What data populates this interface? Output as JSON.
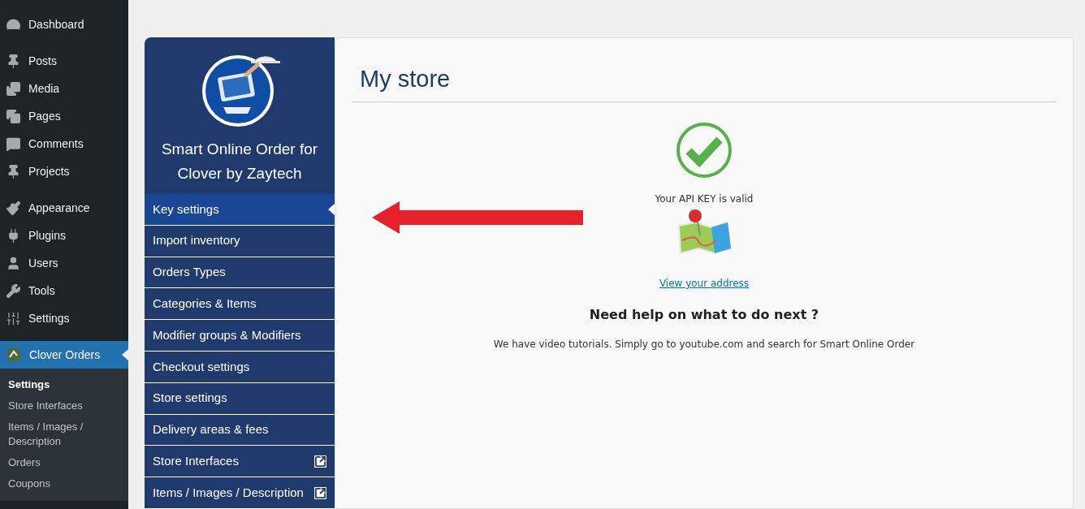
{
  "admin_menu": {
    "groups": [
      [
        {
          "label": "Dashboard",
          "kind": "gauge",
          "selected": false
        }
      ],
      [
        {
          "label": "Posts",
          "kind": "pin",
          "selected": false
        },
        {
          "label": "Media",
          "kind": "media",
          "selected": false
        },
        {
          "label": "Pages",
          "kind": "pages",
          "selected": false
        },
        {
          "label": "Comments",
          "kind": "comment",
          "selected": false
        },
        {
          "label": "Projects",
          "kind": "pin",
          "selected": false
        }
      ],
      [
        {
          "label": "Appearance",
          "kind": "brush",
          "selected": false
        },
        {
          "label": "Plugins",
          "kind": "plug",
          "selected": false
        },
        {
          "label": "Users",
          "kind": "user",
          "selected": false
        },
        {
          "label": "Tools",
          "kind": "wrench",
          "selected": false
        },
        {
          "label": "Settings",
          "kind": "sliders",
          "selected": false
        }
      ],
      [
        {
          "label": "Clover Orders",
          "kind": "clover",
          "selected": true
        }
      ]
    ],
    "submenu": [
      {
        "label": "Settings",
        "selected": true
      },
      {
        "label": "Store Interfaces",
        "selected": false
      },
      {
        "label": "Items / Images / Description",
        "selected": false
      },
      {
        "label": "Orders",
        "selected": false
      },
      {
        "label": "Coupons",
        "selected": false
      }
    ]
  },
  "plugin_panel": {
    "title": "Smart Online Order for Clover by Zaytech",
    "nav": [
      {
        "label": "Key settings",
        "selected": true,
        "external": false
      },
      {
        "label": "Import inventory",
        "selected": false,
        "external": false
      },
      {
        "label": "Orders Types",
        "selected": false,
        "external": false
      },
      {
        "label": "Categories & Items",
        "selected": false,
        "external": false
      },
      {
        "label": "Modifier groups & Modifiers",
        "selected": false,
        "external": false
      },
      {
        "label": "Checkout settings",
        "selected": false,
        "external": false
      },
      {
        "label": "Store settings",
        "selected": false,
        "external": false
      },
      {
        "label": "Delivery areas & fees",
        "selected": false,
        "external": false
      },
      {
        "label": "Store Interfaces",
        "selected": false,
        "external": true
      },
      {
        "label": "Items / Images / Description",
        "selected": false,
        "external": true
      }
    ]
  },
  "main": {
    "title": "My store",
    "api_status": "Your API KEY is valid",
    "address_link": "View your address",
    "help_heading": "Need help on what to do next ?",
    "help_text": "We have video tutorials. Simply go to youtube.com and search for Smart Online Order"
  }
}
